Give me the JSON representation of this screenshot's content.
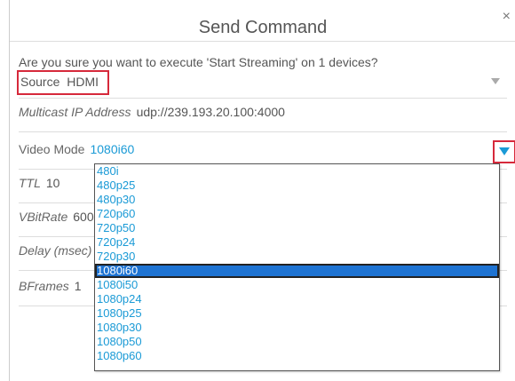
{
  "dialog": {
    "title": "Send Command",
    "close_glyph": "×",
    "question": "Are you sure you want to execute 'Start Streaming' on 1 devices?"
  },
  "fields": {
    "source": {
      "label": "Source",
      "value": "HDMI"
    },
    "multicast": {
      "label": "Multicast IP Address",
      "value": "udp://239.193.20.100:4000"
    },
    "video_mode": {
      "label": "Video Mode",
      "value": "1080i60"
    },
    "ttl": {
      "label": "TTL",
      "value": "10"
    },
    "vbitrate": {
      "label": "VBitRate",
      "value": "600"
    },
    "delay": {
      "label": "Delay (msec)",
      "value": ""
    },
    "bframes": {
      "label": "BFrames",
      "value": "1"
    }
  },
  "video_mode_options": [
    "480i",
    "480p25",
    "480p30",
    "720p60",
    "720p50",
    "720p24",
    "720p30",
    "1080i60",
    "1080i50",
    "1080p24",
    "1080p25",
    "1080p30",
    "1080p50",
    "1080p60"
  ],
  "selected_option": "1080i60",
  "colors": {
    "accent": "#1a9ad6",
    "highlight": "#d6293b",
    "selection": "#1e73d2"
  }
}
